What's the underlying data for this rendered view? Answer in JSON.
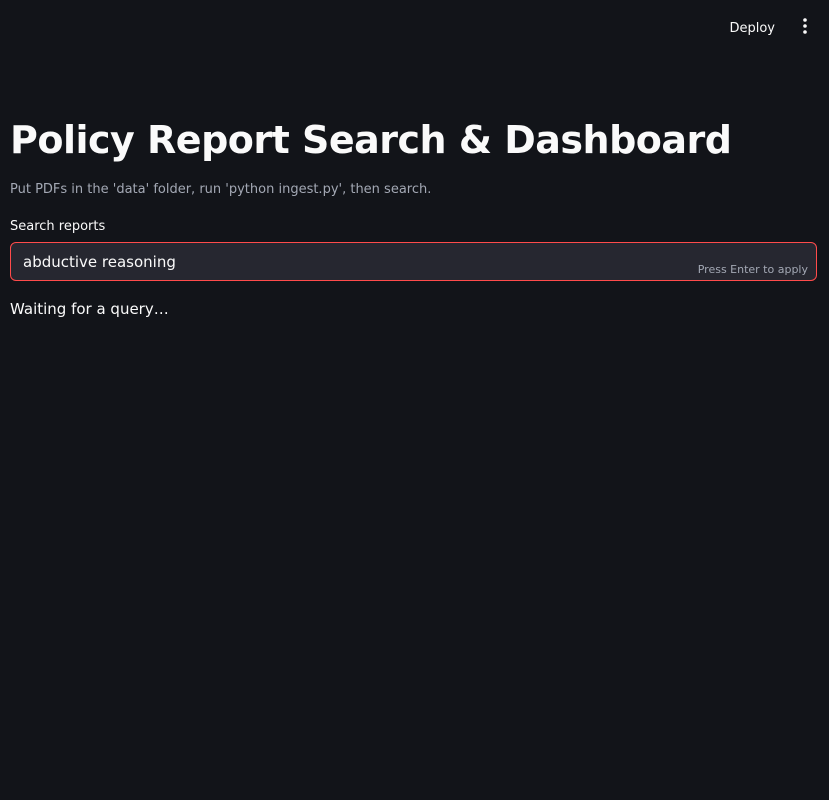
{
  "header": {
    "deploy_label": "Deploy",
    "menu_icon": "vertical-ellipsis-icon"
  },
  "main": {
    "title": "Policy Report Search & Dashboard",
    "caption": "Put PDFs in the 'data' folder, run 'python ingest.py', then search.",
    "search": {
      "label": "Search reports",
      "value": "abductive reasoning",
      "hint": "Press Enter to apply"
    },
    "status_text": "Waiting for a query…"
  },
  "colors": {
    "background": "#121419",
    "input_background": "#262730",
    "focus_border": "#ff4b4b",
    "muted_text": "#a3a8b4",
    "text": "#fafafa"
  }
}
